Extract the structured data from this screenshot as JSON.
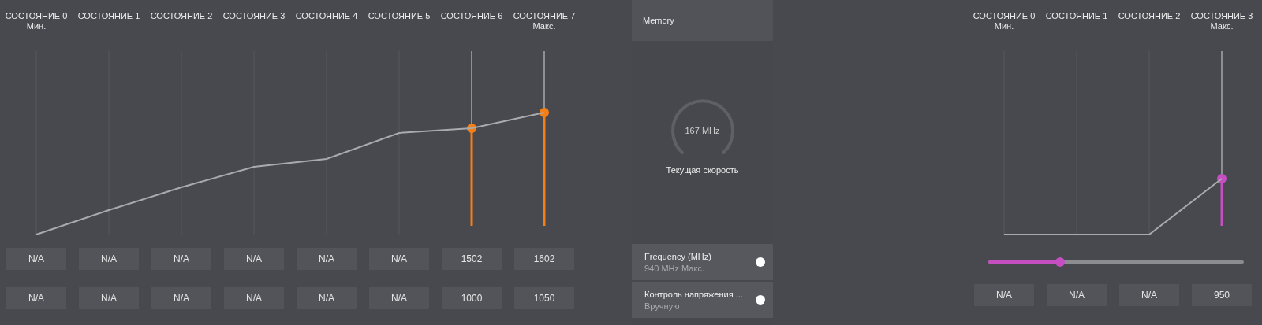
{
  "gpu_states": [
    {
      "label": "СОСТОЯНИЕ 0",
      "sublabel": "Мин.",
      "active": false
    },
    {
      "label": "СОСТОЯНИЕ 1",
      "active": false
    },
    {
      "label": "СОСТОЯНИЕ 2",
      "active": false
    },
    {
      "label": "СОСТОЯНИЕ 3",
      "active": false
    },
    {
      "label": "СОСТОЯНИЕ 4",
      "active": false
    },
    {
      "label": "СОСТОЯНИЕ 5",
      "active": false
    },
    {
      "label": "СОСТОЯНИЕ 6",
      "active": true
    },
    {
      "label": "СОСТОЯНИЕ 7",
      "sublabel": "Макс.",
      "active": true
    }
  ],
  "gpu_rows": [
    [
      "N/A",
      "N/A",
      "N/A",
      "N/A",
      "N/A",
      "N/A",
      "1502",
      "1602"
    ],
    [
      "N/A",
      "N/A",
      "N/A",
      "N/A",
      "N/A",
      "N/A",
      "1000",
      "1050"
    ]
  ],
  "memory": {
    "title": "Memory",
    "gauge": {
      "reading": "167 MHz",
      "caption": "Текущая скорость"
    },
    "items": [
      {
        "label": "Frequency (MHz)",
        "value": "940 MHz Макс.",
        "on": true
      },
      {
        "label": "Контроль напряжения ...",
        "value": "Вручную",
        "on": true
      }
    ]
  },
  "memory_states": [
    {
      "label": "СОСТОЯНИЕ 0",
      "sublabel": "Мин.",
      "active": false
    },
    {
      "label": "СОСТОЯНИЕ 1",
      "active": false
    },
    {
      "label": "СОСТОЯНИЕ 2",
      "active": false
    },
    {
      "label": "СОСТОЯНИЕ 3",
      "sublabel": "Макс.",
      "active": true
    }
  ],
  "memory_slider": {
    "level": 0.28
  },
  "memory_values": [
    "N/A",
    "N/A",
    "N/A",
    "950"
  ]
}
